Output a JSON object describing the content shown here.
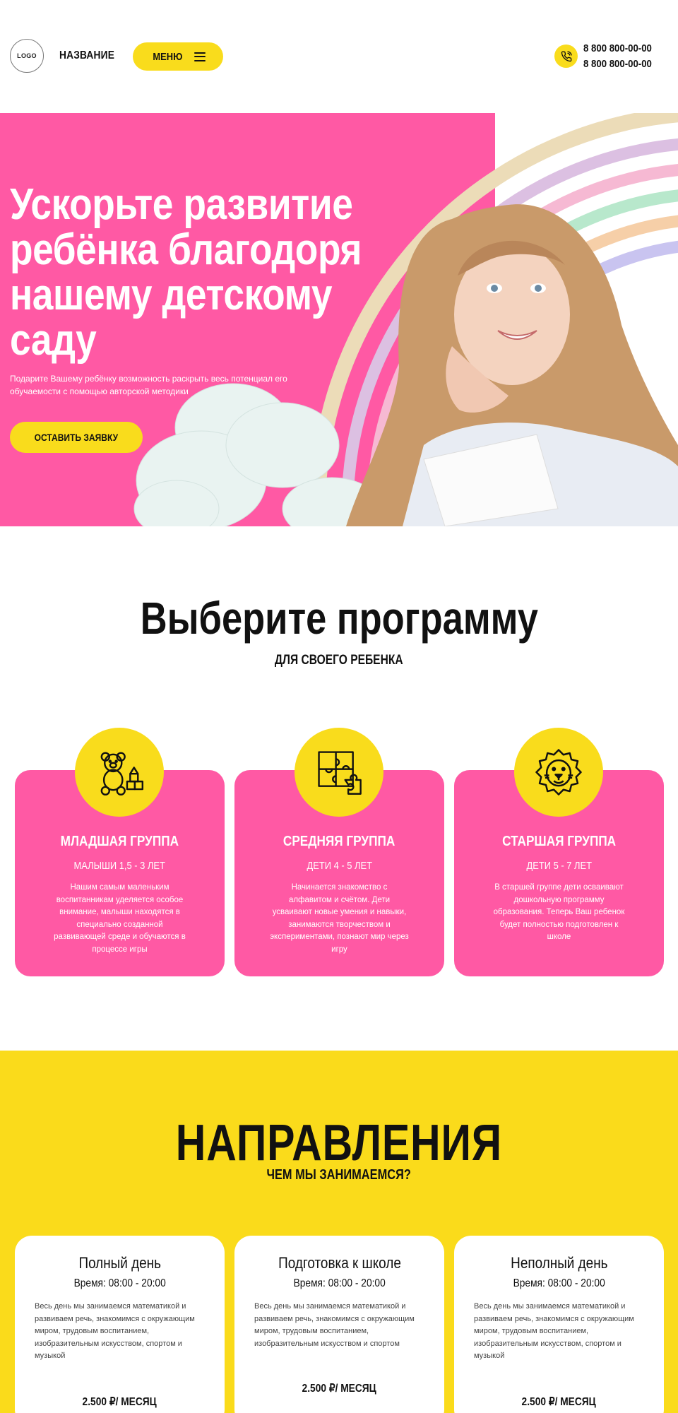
{
  "header": {
    "logo_text": "LOGO",
    "brand_name": "НАЗВАНИЕ",
    "menu_label": "МЕНЮ",
    "phones": [
      "8 800 800-00-00",
      "8 800 800-00-00"
    ]
  },
  "hero": {
    "title_lines": [
      "Ускорьте развитие",
      "ребёнка благодоря",
      "нашему детскому",
      "саду"
    ],
    "subtitle": "Подарите Вашему ребёнку возможность раскрыть весь потенциал его обучаемости с помощью авторской методики",
    "cta_label": "ОСТАВИТЬ ЗАЯВКУ"
  },
  "programs": {
    "title": "Выберите программу",
    "subtitle": "ДЛЯ СВОЕГО РЕБЕНКА",
    "cards": [
      {
        "icon": "teddy-bear-icon",
        "title": "МЛАДШАЯ ГРУППА",
        "age": "МАЛЫШИ 1,5 - 3 ЛЕТ",
        "text": "Нашим самым маленьким воспитанникам уделяется особое внимание, малыши находятся в специально созданной развивающей среде и обучаются в процессе игры"
      },
      {
        "icon": "puzzle-icon",
        "title": "СРЕДНЯЯ ГРУППА",
        "age": "ДЕТИ 4 - 5 ЛЕТ",
        "text": "Начинается знакомство с алфавитом и счётом. Дети усваивают новые умения и навыки, занимаются творчеством и экспериментами, познают мир через игру"
      },
      {
        "icon": "lion-icon",
        "title": "СТАРШАЯ ГРУППА",
        "age": "ДЕТИ 5 - 7 ЛЕТ",
        "text": "В старшей группе дети осваивают дошкольную программу образования. Теперь Ваш ребенок будет полностью подготовлен к школе"
      }
    ]
  },
  "directions": {
    "title": "НАПРАВЛЕНИЯ",
    "subtitle": "ЧЕМ МЫ ЗАНИМАЕМСЯ?",
    "cards": [
      {
        "title": "Полный день",
        "time": "Время: 08:00 - 20:00",
        "text": "Весь день мы занимаемся математикой и развиваем речь, знакомимся с окружающим миром, трудовым воспитанием, изобразительным искусством, спортом и музыкой",
        "price": "2.500 ₽/ МЕСЯЦ"
      },
      {
        "title": "Подготовка к школе",
        "time": "Время: 08:00 - 20:00",
        "text": "Весь день мы занимаемся математикой и развиваем речь, знакомимся с окружающим миром, трудовым воспитанием, изобразительным искусством и спортом",
        "price": "2.500 ₽/ МЕСЯЦ"
      },
      {
        "title": "Неполный день",
        "time": "Время: 08:00 - 20:00",
        "text": "Весь день мы занимаемся математикой и развиваем речь, знакомимся с окружающим миром, трудовым воспитанием, изобразительным искусством, спортом и музыкой",
        "price": "2.500 ₽/ МЕСЯЦ"
      }
    ]
  },
  "colors": {
    "accent_yellow": "#f9dc1c",
    "accent_pink": "#ff59a4"
  }
}
